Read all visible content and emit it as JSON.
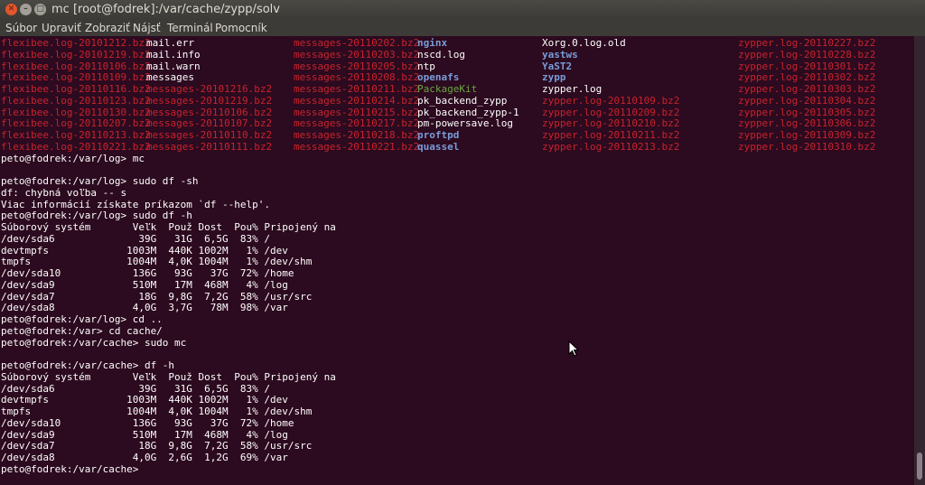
{
  "window": {
    "title": "mc [root@fodrek]:/var/cache/zypp/solv"
  },
  "menu": [
    "Súbor",
    "Upraviť",
    "Zobraziť",
    "Nájsť",
    "Terminál",
    "Pomocník"
  ],
  "listing": [
    [
      "flexibee.log-20101212.bz2",
      "mail.err",
      "messages-20110202.bz2",
      "nginx",
      "Xorg.0.log.old",
      "zypper.log-20110227.bz2"
    ],
    [
      "flexibee.log-20101219.bz2",
      "mail.info",
      "messages-20110203.bz2",
      "nscd.log",
      "yastws",
      "zypper.log-20110228.bz2"
    ],
    [
      "flexibee.log-20110106.bz2",
      "mail.warn",
      "messages-20110205.bz2",
      "ntp",
      "YaST2",
      "zypper.log-20110301.bz2"
    ],
    [
      "flexibee.log-20110109.bz2",
      "messages",
      "messages-20110208.bz2",
      "openafs",
      "zypp",
      "zypper.log-20110302.bz2"
    ],
    [
      "flexibee.log-20110116.bz2",
      "messages-20101216.bz2",
      "messages-20110211.bz2",
      "PackageKit",
      "zypper.log",
      "zypper.log-20110303.bz2"
    ],
    [
      "flexibee.log-20110123.bz2",
      "messages-20101219.bz2",
      "messages-20110214.bz2",
      "pk_backend_zypp",
      "zypper.log-20110109.bz2",
      "zypper.log-20110304.bz2"
    ],
    [
      "flexibee.log-20110130.bz2",
      "messages-20110106.bz2",
      "messages-20110215.bz2",
      "pk_backend_zypp-1",
      "zypper.log-20110209.bz2",
      "zypper.log-20110305.bz2"
    ],
    [
      "flexibee.log-20110207.bz2",
      "messages-20110107.bz2",
      "messages-20110217.bz2",
      "pm-powersave.log",
      "zypper.log-20110210.bz2",
      "zypper.log-20110306.bz2"
    ],
    [
      "flexibee.log-20110213.bz2",
      "messages-20110110.bz2",
      "messages-20110218.bz2",
      "proftpd",
      "zypper.log-20110211.bz2",
      "zypper.log-20110309.bz2"
    ],
    [
      "flexibee.log-20110221.bz2",
      "messages-20110111.bz2",
      "messages-20110221.bz2",
      "quassel",
      "zypper.log-20110213.bz2",
      "zypper.log-20110310.bz2"
    ]
  ],
  "listing_colors": [
    [
      "red",
      "white",
      "red",
      "blue",
      "white",
      "red"
    ],
    [
      "red",
      "white",
      "red",
      "white",
      "blue",
      "red"
    ],
    [
      "red",
      "white",
      "red",
      "white",
      "blue",
      "red"
    ],
    [
      "red",
      "white",
      "red",
      "blue",
      "blue",
      "red"
    ],
    [
      "red",
      "red",
      "red",
      "green",
      "white",
      "red"
    ],
    [
      "red",
      "red",
      "red",
      "white",
      "red",
      "red"
    ],
    [
      "red",
      "red",
      "red",
      "white",
      "red",
      "red"
    ],
    [
      "red",
      "red",
      "red",
      "white",
      "red",
      "red"
    ],
    [
      "red",
      "red",
      "red",
      "blue",
      "red",
      "red"
    ],
    [
      "red",
      "red",
      "red",
      "blue",
      "red",
      "red"
    ]
  ],
  "palette": {
    "red": "#c9232d",
    "white": "#ffffff",
    "blue": "#7a9cd9",
    "green": "#6aa542",
    "background": "#2c0a1f"
  },
  "output_lines": [
    "peto@fodrek:/var/log> mc",
    "",
    "peto@fodrek:/var/log> sudo df -sh",
    "df: chybná voľba -- s",
    "Viac informácií získate príkazom `df --help'.",
    "peto@fodrek:/var/log> sudo df -h",
    "Súborový systém       Veľk  Použ Dost  Pou% Pripojený na",
    "/dev/sda6              39G   31G  6,5G  83% /",
    "devtmpfs             1003M  440K 1002M   1% /dev",
    "tmpfs                1004M  4,0K 1004M   1% /dev/shm",
    "/dev/sda10            136G   93G   37G  72% /home",
    "/dev/sda9             510M   17M  468M   4% /log",
    "/dev/sda7              18G  9,8G  7,2G  58% /usr/src",
    "/dev/sda8             4,0G  3,7G   78M  98% /var",
    "peto@fodrek:/var/log> cd ..",
    "peto@fodrek:/var> cd cache/",
    "peto@fodrek:/var/cache> sudo mc",
    "",
    "peto@fodrek:/var/cache> df -h",
    "Súborový systém       Veľk  Použ Dost  Pou% Pripojený na",
    "/dev/sda6              39G   31G  6,5G  83% /",
    "devtmpfs             1003M  440K 1002M   1% /dev",
    "tmpfs                1004M  4,0K 1004M   1% /dev/shm",
    "/dev/sda10            136G   93G   37G  72% /home",
    "/dev/sda9             510M   17M  468M   4% /log",
    "/dev/sda7              18G  9,8G  7,2G  58% /usr/src",
    "/dev/sda8             4,0G  2,6G  1,2G  69% /var",
    "peto@fodrek:/var/cache> "
  ]
}
